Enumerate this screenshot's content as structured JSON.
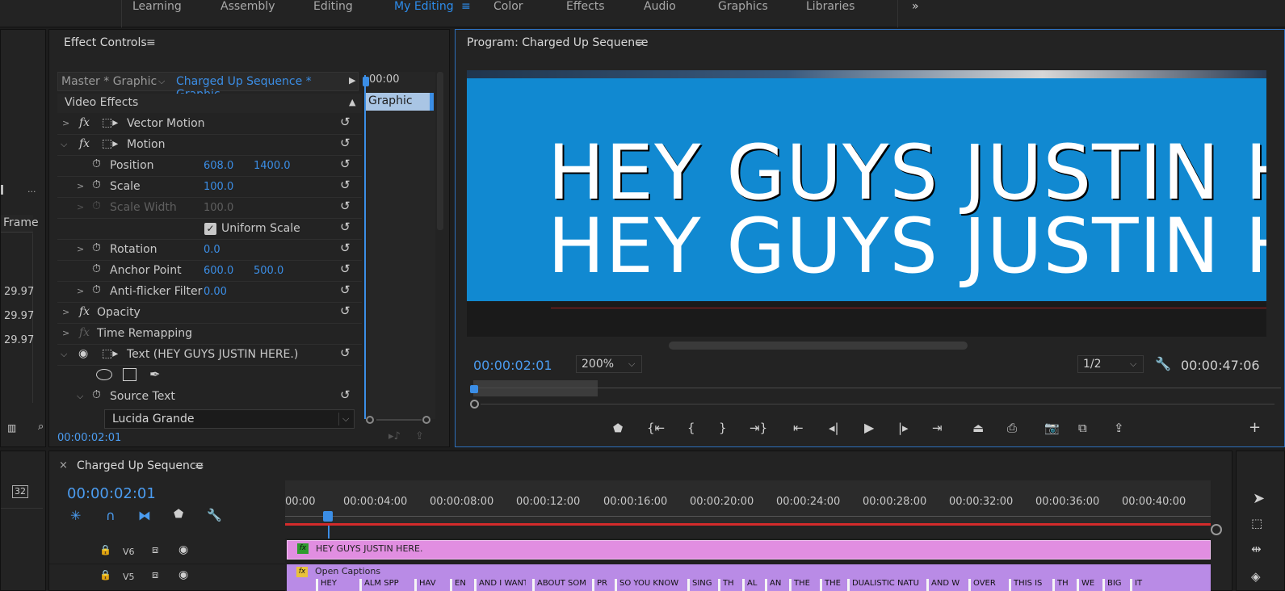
{
  "workspaces": [
    "Learning",
    "Assembly",
    "Editing",
    "My Editing",
    "Color",
    "Effects",
    "Audio",
    "Graphics",
    "Libraries"
  ],
  "workspace_active": "My Editing",
  "workspace_menu_icon": "hamburger-icon",
  "more_icon": "double-chevron-right-icon",
  "left_panel": {
    "frame_header": "Frame",
    "frame_values": [
      "29.97",
      "29.97",
      "29.97"
    ],
    "ellipsis": "..."
  },
  "effect_controls": {
    "title": "Effect Controls",
    "master": "Master * Graphic",
    "sequence": "Charged Up Sequence * Graphic",
    "mini_time": "00:00",
    "clip_label": "Graphic",
    "section": "Video Effects",
    "rows": {
      "vector_motion": "Vector Motion",
      "motion": "Motion",
      "position": "Position",
      "position_x": "608.0",
      "position_y": "1400.0",
      "scale": "Scale",
      "scale_val": "100.0",
      "scale_width": "Scale Width",
      "scale_width_val": "100.0",
      "uniform_scale": "Uniform Scale",
      "rotation": "Rotation",
      "rotation_val": "0.0",
      "anchor": "Anchor Point",
      "anchor_x": "600.0",
      "anchor_y": "500.0",
      "antiflicker": "Anti-flicker Filter",
      "antiflicker_val": "0.00",
      "opacity": "Opacity",
      "time_remap": "Time Remapping",
      "text": "Text (HEY GUYS JUSTIN HERE.)",
      "source_text": "Source Text",
      "font": "Lucida Grande"
    },
    "timecode": "00:00:02:01"
  },
  "program": {
    "title": "Program: Charged Up Sequence",
    "caption_line1": "HEY GUYS JUSTIN H",
    "caption_line2": "HEY GUYS JUSTIN H",
    "timecode": "00:00:02:01",
    "zoom": "200%",
    "resolution": "1/2",
    "duration": "00:00:47:06",
    "accent_color": "#1189d1"
  },
  "timeline": {
    "tab_title": "Charged Up Sequence",
    "close": "×",
    "timecode": "00:00:02:01",
    "ruler": [
      "00:00",
      "00:00:04:00",
      "00:00:08:00",
      "00:00:12:00",
      "00:00:16:00",
      "00:00:20:00",
      "00:00:24:00",
      "00:00:28:00",
      "00:00:32:00",
      "00:00:36:00",
      "00:00:40:00"
    ],
    "tracks": [
      {
        "name": "V6",
        "clip": "HEY GUYS JUSTIN HERE."
      },
      {
        "name": "V5",
        "clip": "Open Captions"
      }
    ],
    "caption_segments": [
      "HEY",
      "ALM SPP",
      "HAV",
      "EN",
      "AND I WANT",
      "ABOUT SOM",
      "PR",
      "SO YOU KNOW I THI",
      "SING",
      "TH",
      "AL",
      "AN",
      "THE",
      "THE",
      "DUALISTIC NATU",
      "AND W",
      "OVER",
      "THIS IS",
      "TH",
      "WE",
      "BIG",
      "IT"
    ],
    "clip_color": "#e18ee1",
    "caption_color": "#b98be6"
  },
  "tools_badge": "32"
}
